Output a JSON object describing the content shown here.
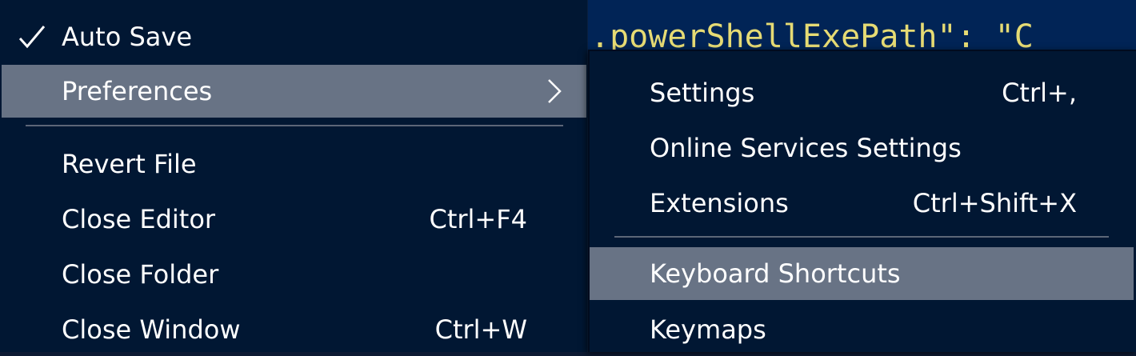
{
  "editor": {
    "code_text": ".powerShellExePath\": \"C"
  },
  "file_menu": {
    "items": [
      {
        "label": "Auto Save",
        "checked": true,
        "shortcut": ""
      },
      {
        "label": "Preferences",
        "shortcut": "",
        "has_submenu": true,
        "highlighted": true
      },
      {
        "label": "Revert File",
        "shortcut": ""
      },
      {
        "label": "Close Editor",
        "shortcut": "Ctrl+F4"
      },
      {
        "label": "Close Folder",
        "shortcut": ""
      },
      {
        "label": "Close Window",
        "shortcut": "Ctrl+W"
      }
    ]
  },
  "preferences_menu": {
    "items": [
      {
        "label": "Settings",
        "shortcut": "Ctrl+,"
      },
      {
        "label": "Online Services Settings",
        "shortcut": ""
      },
      {
        "label": "Extensions",
        "shortcut": "Ctrl+Shift+X"
      },
      {
        "label": "Keyboard Shortcuts",
        "shortcut": "",
        "highlighted": true
      },
      {
        "label": "Keymaps",
        "shortcut": ""
      }
    ]
  },
  "icons": {
    "check": "checkmark-icon",
    "submenu": "chevron-right-icon"
  },
  "colors": {
    "menu_background": "#011733",
    "highlight": "#687385",
    "editor_background": "#012456",
    "code_string": "#e6db74"
  }
}
